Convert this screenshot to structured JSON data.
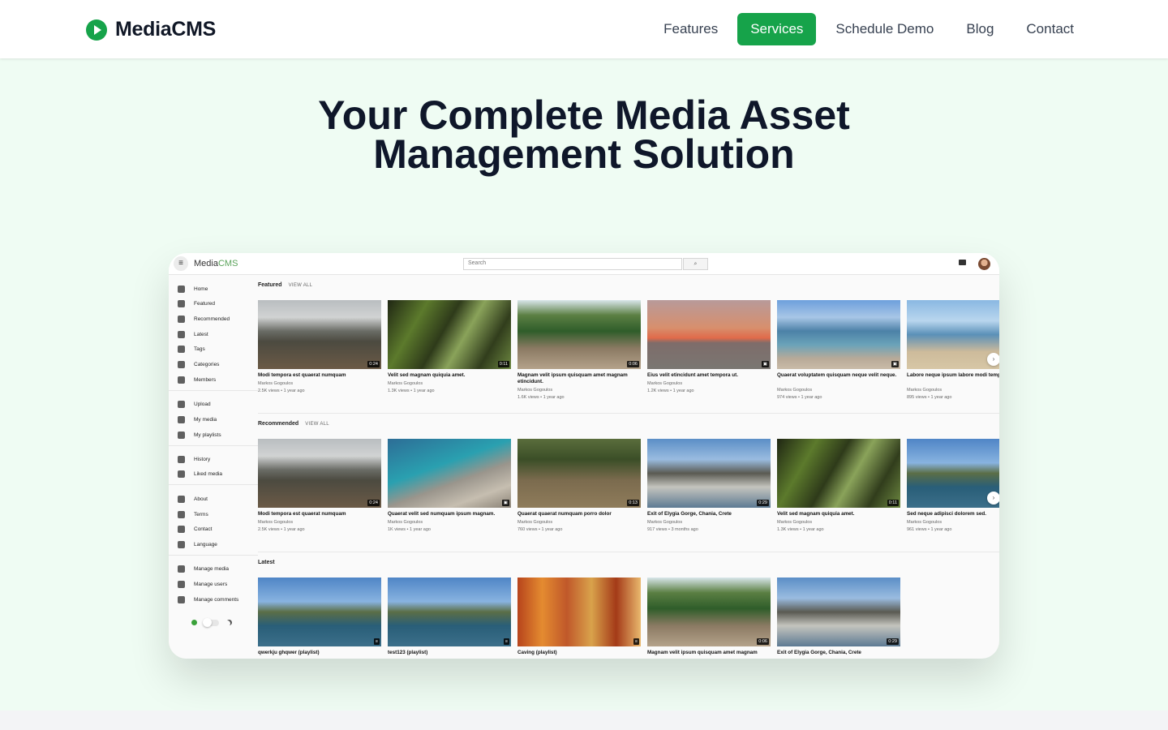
{
  "nav": {
    "brand": "MediaCMS",
    "links": [
      "Features",
      "Services",
      "Schedule Demo",
      "Blog",
      "Contact"
    ],
    "active_link": "Services"
  },
  "hero": {
    "title_line1": "Your Complete Media Asset",
    "title_line2": "Management Solution"
  },
  "app": {
    "brand_prefix": "Media",
    "brand_suffix": "CMS",
    "search_placeholder": "Search",
    "sidebar": [
      "Home",
      "Featured",
      "Recommended",
      "Latest",
      "Tags",
      "Categories",
      "Members",
      "Upload",
      "My media",
      "My playlists",
      "History",
      "Liked media",
      "About",
      "Terms",
      "Contact",
      "Language",
      "Manage media",
      "Manage users",
      "Manage comments"
    ],
    "sections": [
      {
        "title": "Featured",
        "view_all": "VIEW ALL",
        "cards": [
          {
            "title": "Modi tempora est quaerat numquam",
            "author": "Markos Gogoulos",
            "meta": "2.5K views • 1 year ago",
            "dur": "0:24",
            "thumb": "t-mountain"
          },
          {
            "title": "Velit sed magnam quiquia amet.",
            "author": "Markos Gogoulos",
            "meta": "1.3K views • 1 year ago",
            "dur": "0:11",
            "thumb": "t-blur"
          },
          {
            "title": "Magnam velit ipsum quisquam amet magnam etincidunt.",
            "author": "Markos Gogoulos",
            "meta": "1.6K views • 1 year ago",
            "dur": "0:06",
            "thumb": "t-road"
          },
          {
            "title": "Eius velit etincidunt amet tempora ut.",
            "author": "Markos Gogoulos",
            "meta": "1.2K views • 1 year ago",
            "dur": "▣",
            "thumb": "t-sunset"
          },
          {
            "title": "Quaerat voluptatem quisquam neque velit neque.",
            "author": "Markos Gogoulos",
            "meta": "974 views • 1 year ago",
            "dur": "▣",
            "thumb": "t-beach"
          },
          {
            "title": "Labore neque ipsum labore modi tempora neque.",
            "author": "Markos Gogoulos",
            "meta": "895 views • 1 year ago",
            "dur": "",
            "thumb": "t-sand"
          }
        ]
      },
      {
        "title": "Recommended",
        "view_all": "VIEW ALL",
        "cards": [
          {
            "title": "Modi tempora est quaerat numquam",
            "author": "Markos Gogoulos",
            "meta": "2.5K views • 1 year ago",
            "dur": "0:24",
            "thumb": "t-mountain"
          },
          {
            "title": "Quaerat velit sed numquam ipsum magnam.",
            "author": "Markos Gogoulos",
            "meta": "1K views • 1 year ago",
            "dur": "▣",
            "thumb": "t-rocks"
          },
          {
            "title": "Quaerat quaerat numquam porro dolor",
            "author": "Markos Gogoulos",
            "meta": "760 views • 1 year ago",
            "dur": "0:13",
            "thumb": "t-trail"
          },
          {
            "title": "Exit of Elygia Gorge, Chania, Crete",
            "author": "Markos Gogoulos",
            "meta": "917 views • 3 months ago",
            "dur": "0:29",
            "thumb": "t-gorge"
          },
          {
            "title": "Velit sed magnam quiquia amet.",
            "author": "Markos Gogoulos",
            "meta": "1.3K views • 1 year ago",
            "dur": "0:11",
            "thumb": "t-blur"
          },
          {
            "title": "Sed neque adipisci dolorem sed.",
            "author": "Markos Gogoulos",
            "meta": "961 views • 1 year ago",
            "dur": "",
            "thumb": "t-lake"
          }
        ]
      },
      {
        "title": "Latest",
        "view_all": "",
        "cards": [
          {
            "title": "qwerkju ghqwer (playlist)",
            "author": "",
            "meta": "",
            "dur": "≡",
            "thumb": "t-lake"
          },
          {
            "title": "test123 (playlist)",
            "author": "",
            "meta": "",
            "dur": "≡",
            "thumb": "t-lake"
          },
          {
            "title": "Caving (playlist)",
            "author": "",
            "meta": "",
            "dur": "≡",
            "thumb": "t-autumn"
          },
          {
            "title": "Magnam velit ipsum quisquam amet magnam",
            "author": "",
            "meta": "",
            "dur": "0:06",
            "thumb": "t-road"
          },
          {
            "title": "Exit of Elygia Gorge, Chania, Crete",
            "author": "",
            "meta": "",
            "dur": "0:29",
            "thumb": "t-gorge"
          }
        ]
      }
    ]
  },
  "colors": {
    "accent": "#16a34a",
    "hero_bg": "#effcf3"
  }
}
